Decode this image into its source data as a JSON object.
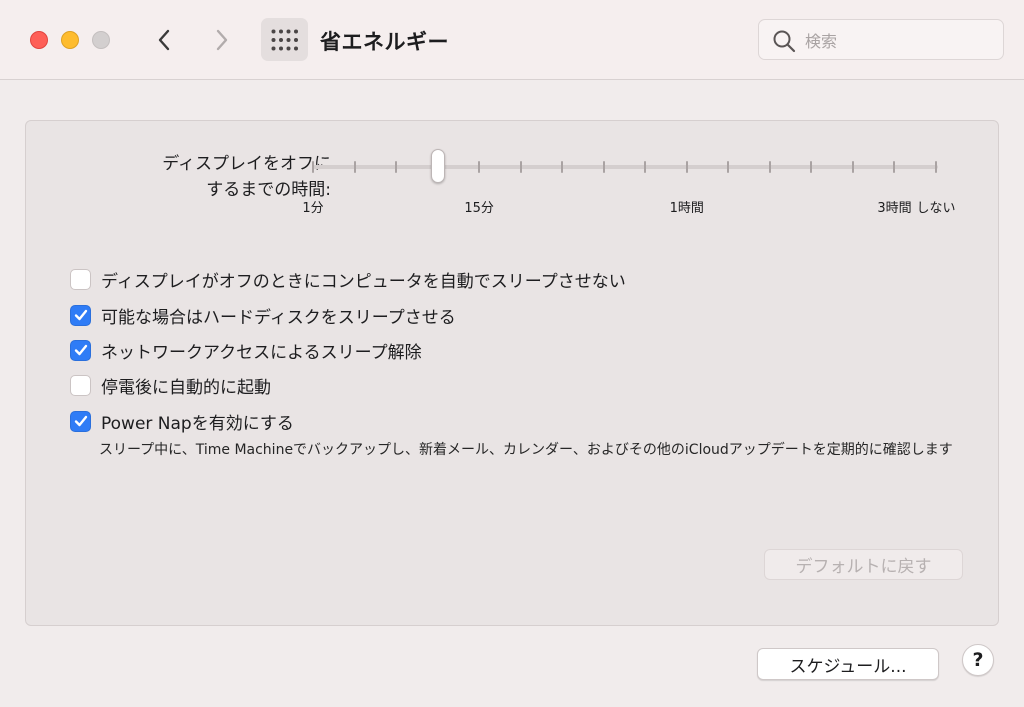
{
  "window": {
    "title": "省エネルギー"
  },
  "toolbar": {
    "back_icon": "chevron-left-icon",
    "forward_icon": "chevron-right-icon",
    "grid_icon": "grid-icon"
  },
  "search": {
    "placeholder": "検索",
    "value": ""
  },
  "display_sleep": {
    "label_line1": "ディスプレイをオフに",
    "label_line2": "するまでの時間:",
    "selected_value": "5分",
    "selected_tick_index": 3,
    "tick_count": 16,
    "tick_labels": [
      {
        "text": "1分",
        "tick_index": 0
      },
      {
        "text": "15分",
        "tick_index": 4
      },
      {
        "text": "1時間",
        "tick_index": 9
      },
      {
        "text": "3時間",
        "tick_index": 14
      },
      {
        "text": "しない",
        "tick_index": 15
      }
    ]
  },
  "options": [
    {
      "id": "prevent-sleep",
      "label": "ディスプレイがオフのときにコンピュータを自動でスリープさせない",
      "checked": false
    },
    {
      "id": "disk-sleep",
      "label": "可能な場合はハードディスクをスリープさせる",
      "checked": true
    },
    {
      "id": "network-wake",
      "label": "ネットワークアクセスによるスリープ解除",
      "checked": true
    },
    {
      "id": "auto-start",
      "label": "停電後に自動的に起動",
      "checked": false
    },
    {
      "id": "power-nap",
      "label": "Power Napを有効にする",
      "checked": true
    }
  ],
  "power_nap_description": "スリープ中に、Time Machineでバックアップし、新着メール、カレンダー、およびその他のiCloudアップデートを定期的に確認します",
  "buttons": {
    "restore_defaults": "デフォルトに戻す",
    "schedule": "スケジュール...",
    "help": "?"
  },
  "colors": {
    "accent": "#2f7cf6",
    "close": "#fe5f57",
    "minimize": "#febc2e",
    "zoom_inactive": "#d3cfcf"
  }
}
